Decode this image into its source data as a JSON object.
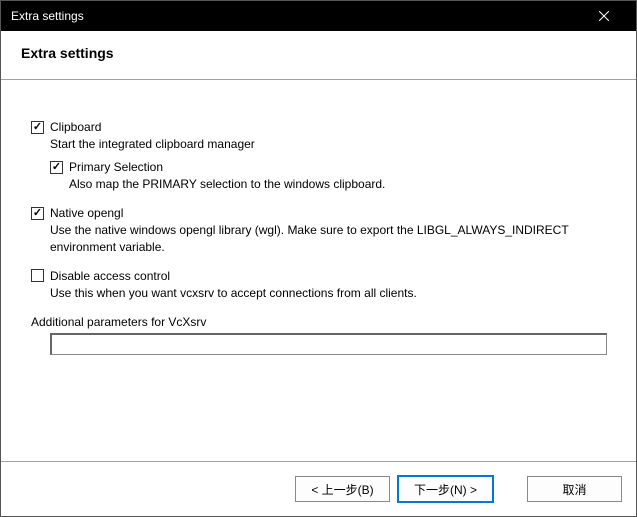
{
  "titlebar": {
    "title": "Extra settings"
  },
  "header": {
    "title": "Extra settings"
  },
  "options": {
    "clipboard": {
      "label": "Clipboard",
      "checked": true,
      "description": "Start the integrated clipboard manager",
      "primarySelection": {
        "label": "Primary Selection",
        "checked": true,
        "description": "Also map the PRIMARY selection to the windows clipboard."
      }
    },
    "nativeOpengl": {
      "label": "Native opengl",
      "checked": true,
      "description": "Use the native windows opengl library (wgl). Make sure to export the LIBGL_ALWAYS_INDIRECT environment variable."
    },
    "disableAccessControl": {
      "label": "Disable access control",
      "checked": false,
      "description": "Use this when you want vcxsrv to accept connections from all clients."
    },
    "additionalParams": {
      "label": "Additional parameters for VcXsrv",
      "value": ""
    }
  },
  "buttons": {
    "back": "< 上一步(B)",
    "next": "下一步(N) >",
    "cancel": "取消"
  }
}
